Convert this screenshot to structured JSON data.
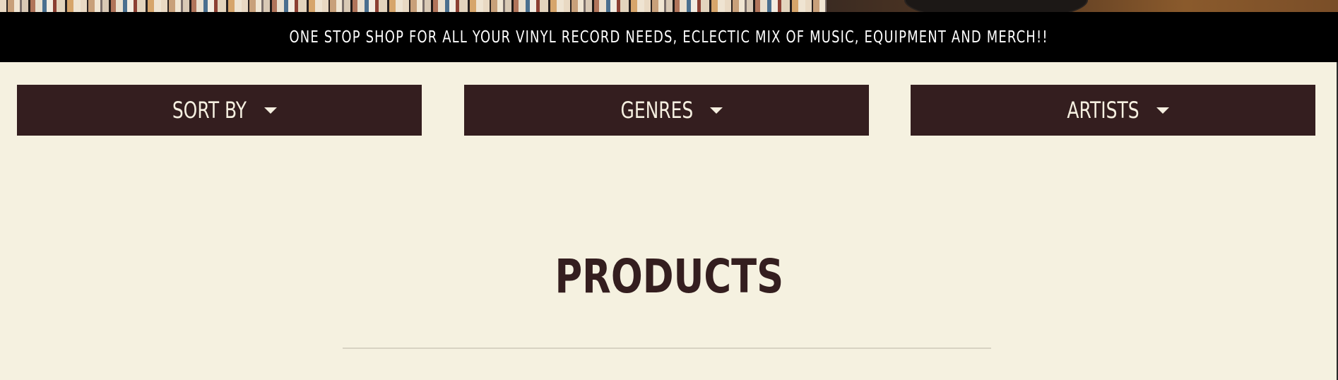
{
  "announcement": {
    "text": "ONE STOP SHOP FOR ALL YOUR VINYL RECORD NEEDS, ECLECTIC MIX OF MUSIC, EQUIPMENT AND MERCH!!"
  },
  "filters": [
    {
      "label": "SORT BY",
      "icon": "caret-down-icon"
    },
    {
      "label": "GENRES",
      "icon": "caret-down-icon"
    },
    {
      "label": "ARTISTS",
      "icon": "caret-down-icon"
    }
  ],
  "main": {
    "heading": "PRODUCTS"
  },
  "colors": {
    "page_background": "#f5f1e0",
    "announcement_background": "#000000",
    "filter_background": "#341e1f",
    "filter_text": "#f5efe0",
    "heading_text": "#341e1f",
    "divider": "#d8d3c3"
  }
}
